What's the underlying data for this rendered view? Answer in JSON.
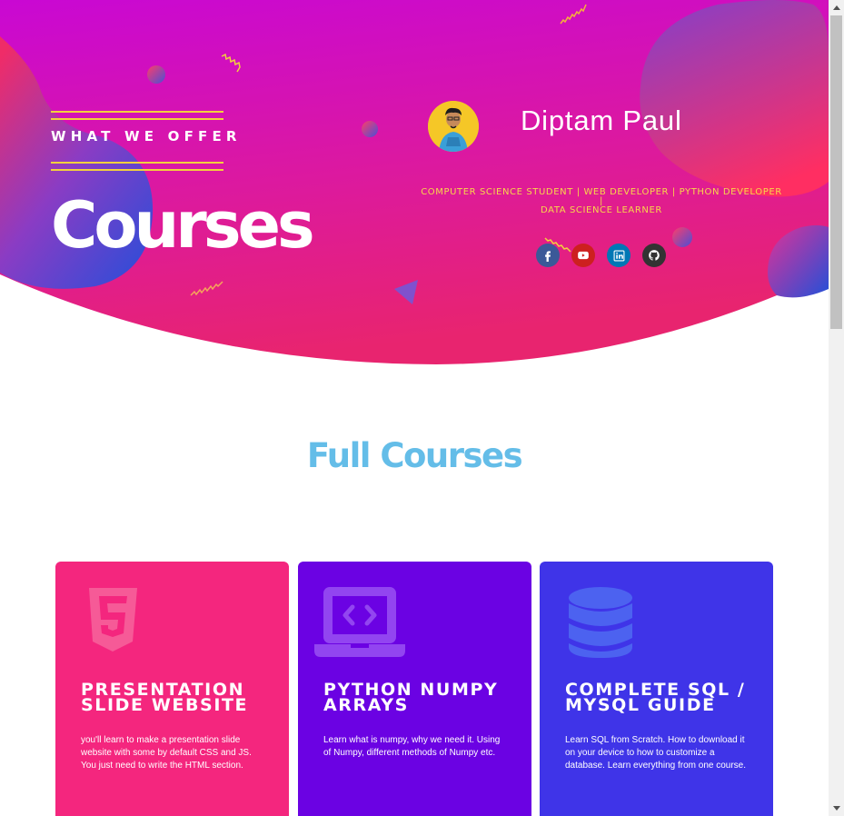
{
  "hero": {
    "eyebrow": "WHAT WE OFFER",
    "title": "Courses",
    "name": "Diptam Paul",
    "roles_line1": "COMPUTER SCIENCE STUDENT | WEB DEVELOPER | PYTHON DEVELOPER |",
    "roles_line2": "DATA SCIENCE LEARNER",
    "social": [
      {
        "name": "facebook",
        "icon": "facebook-icon",
        "color": "#3b5998"
      },
      {
        "name": "youtube",
        "icon": "youtube-icon",
        "color": "#cd201f"
      },
      {
        "name": "linkedin",
        "icon": "linkedin-icon",
        "color": "#0077b5"
      },
      {
        "name": "github",
        "icon": "github-icon",
        "color": "#333333"
      }
    ]
  },
  "section": {
    "title": "Full Courses"
  },
  "cards": [
    {
      "icon": "html5-icon",
      "title": "Presentation Slide Website",
      "description": "you'll learn to make a presentation slide website with some by default CSS and JS. You just need to write the HTML section.",
      "color": "#f4267e"
    },
    {
      "icon": "laptop-code-icon",
      "title": "Python Numpy Arrays",
      "description": "Learn what is numpy, why we need it. Using of Numpy, different methods of Numpy etc.",
      "color": "#6b02e3"
    },
    {
      "icon": "database-icon",
      "title": "Complete SQL / MySQL Guide",
      "description": "Learn SQL from Scratch. How to download it on your device to how to customize a database. Learn everything from one course.",
      "color": "#3f34e8"
    }
  ],
  "colors": {
    "hero_primary": "#c709d2",
    "hero_secondary": "#f22a7a",
    "accent_yellow": "#f2d13d",
    "section_title": "#64bde8"
  }
}
